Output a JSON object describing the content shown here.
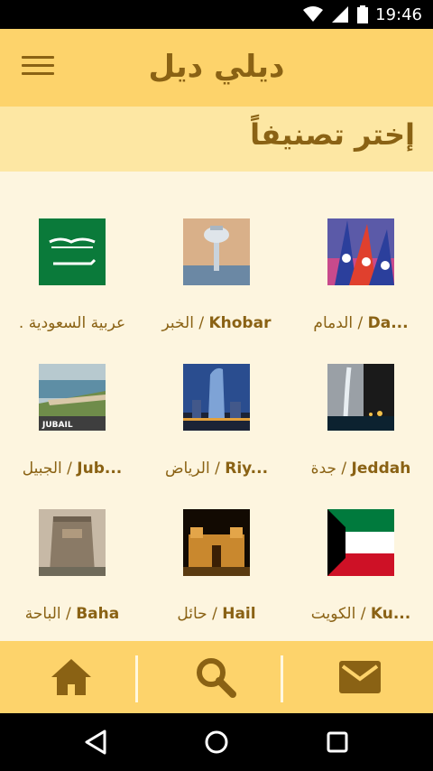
{
  "status_bar": {
    "time": "19:46"
  },
  "app_bar": {
    "title": "ديلي ديل",
    "menu_icon": "menu-icon"
  },
  "section": {
    "title": "إختر تصنيفاً"
  },
  "categories": [
    {
      "en": "Da...",
      "sep": " / ",
      "ar": "الدمام",
      "icon": "dammam-thumb"
    },
    {
      "en": "Khobar",
      "sep": " / ",
      "ar": "الخبر",
      "icon": "khobar-thumb"
    },
    {
      "en": ". عربية السعودية",
      "sep": "",
      "ar": "",
      "icon": "saudi-flag-thumb"
    },
    {
      "en": "Jeddah",
      "sep": " / ",
      "ar": "جدة",
      "icon": "jeddah-thumb"
    },
    {
      "en": "Riy...",
      "sep": " / ",
      "ar": "الرياض",
      "icon": "riyadh-thumb"
    },
    {
      "en": "Jub...",
      "sep": " / ",
      "ar": "الجبيل",
      "icon": "jubail-thumb"
    },
    {
      "en": "Ku...",
      "sep": " / ",
      "ar": "الكويت",
      "icon": "kuwait-flag-thumb"
    },
    {
      "en": "Hail",
      "sep": " / ",
      "ar": "حائل",
      "icon": "hail-thumb"
    },
    {
      "en": "Baha",
      "sep": " / ",
      "ar": "الباحة",
      "icon": "baha-thumb"
    }
  ],
  "thumb_text": {
    "jubail": "JUBAIL"
  },
  "bottom_nav": {
    "home": "home-icon",
    "search": "search-icon",
    "mail": "mail-icon"
  },
  "colors": {
    "app_bar": "#fdd36b",
    "section": "#fde7a3",
    "background": "#fdf5df",
    "accent": "#8a6214"
  }
}
